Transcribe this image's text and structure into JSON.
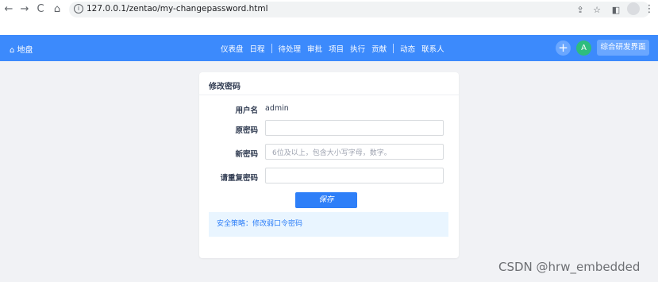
{
  "browser": {
    "url": "127.0.0.1/zentao/my-changepassword.html",
    "back_icon": "←",
    "forward_icon": "→",
    "reload_icon": "C",
    "home_icon": "⌂",
    "info_icon": "i",
    "share_icon": "⇪",
    "star_icon": "☆",
    "sidepanel_icon": "◧",
    "menu_icon": "⋮"
  },
  "appbar": {
    "home_label": "地盘",
    "home_icon": "⌂",
    "nav_group1": [
      "仪表盘",
      "日程"
    ],
    "nav_group2": [
      "待处理",
      "审批",
      "项目",
      "执行",
      "贡献"
    ],
    "nav_group3": [
      "动态",
      "联系人"
    ],
    "plus_icon": "+",
    "user_initial": "A",
    "switch_label": "综合研发界面"
  },
  "panel": {
    "title": "修改密码",
    "username_label": "用户名",
    "username_value": "admin",
    "old_password_label": "原密码",
    "new_password_label": "新密码",
    "new_password_placeholder": "6位及以上，包含大小写字母，数字。",
    "repeat_password_label": "请重复密码",
    "save_label": "保存",
    "tip_text": "安全策略：修改弱口令密码"
  },
  "watermark": "CSDN @hrw_embedded"
}
